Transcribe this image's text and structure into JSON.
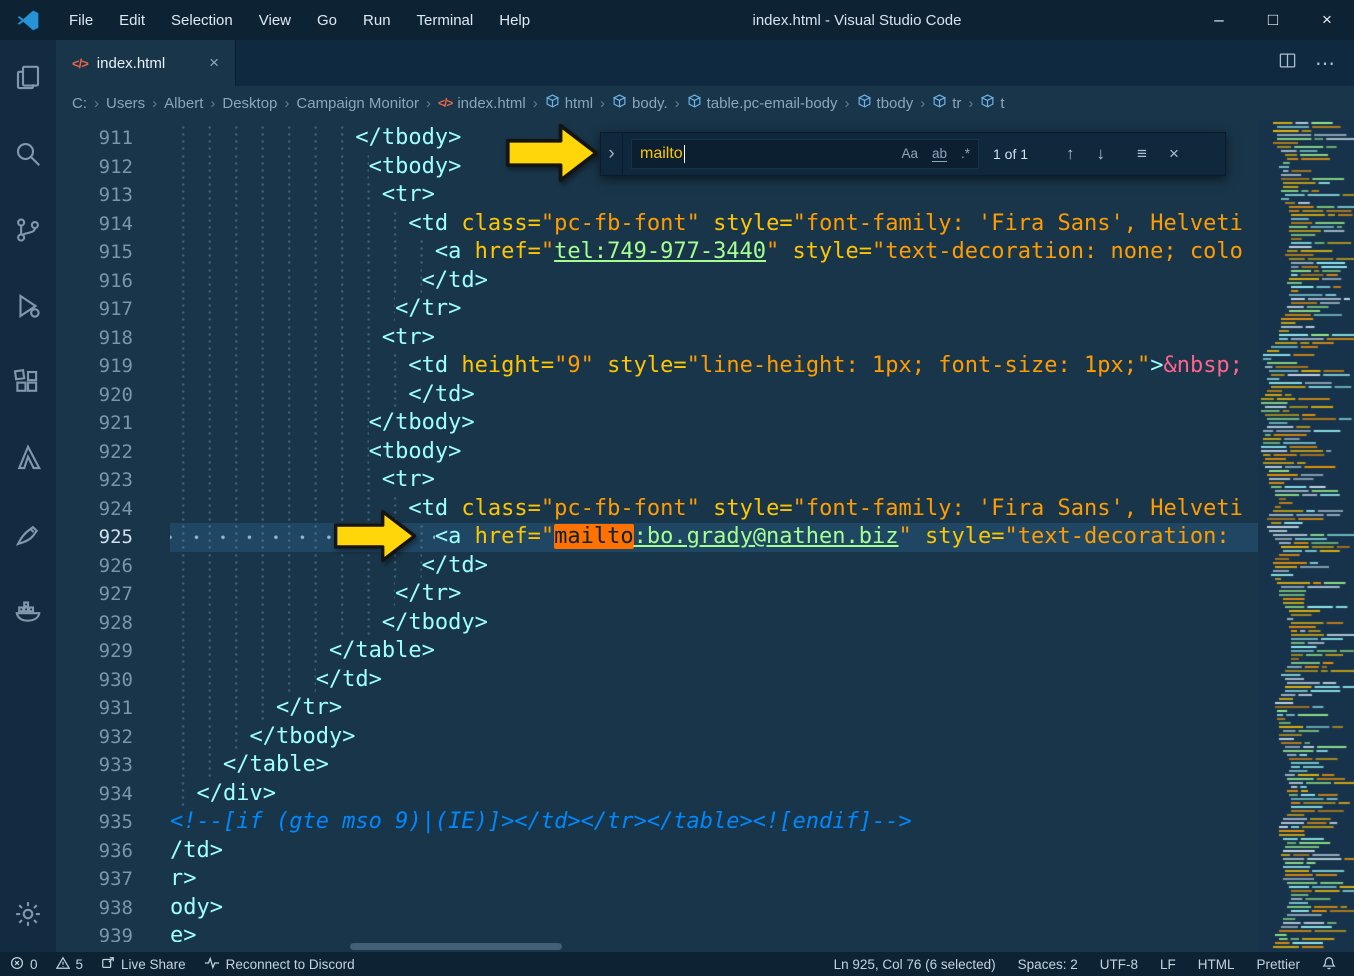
{
  "window": {
    "title": "index.html - Visual Studio Code",
    "minimize": "–",
    "maximize": "□",
    "close": "×"
  },
  "menubar": {
    "items": [
      "File",
      "Edit",
      "Selection",
      "View",
      "Go",
      "Run",
      "Terminal",
      "Help"
    ]
  },
  "activity_bar": {
    "top": [
      "explorer",
      "search",
      "source-control",
      "run-debug",
      "extensions",
      "azure",
      "live-share",
      "docker"
    ],
    "bottom": [
      "settings"
    ]
  },
  "tab_bar": {
    "tab_label": "index.html",
    "tab_close": "×",
    "more_actions": "⋯"
  },
  "breadcrumbs": {
    "items": [
      {
        "label": "C:"
      },
      {
        "label": "Users"
      },
      {
        "label": "Albert"
      },
      {
        "label": "Desktop"
      },
      {
        "label": "Campaign Monitor"
      },
      {
        "label": "index.html",
        "icon": "html"
      },
      {
        "label": "html",
        "icon": "cube"
      },
      {
        "label": "body.",
        "icon": "cube"
      },
      {
        "label": "table.pc-email-body",
        "icon": "cube"
      },
      {
        "label": "tbody",
        "icon": "cube"
      },
      {
        "label": "tr",
        "icon": "cube"
      },
      {
        "label": "t",
        "icon": "cube"
      }
    ]
  },
  "find": {
    "expand": "›",
    "query": "mailto",
    "match_case": "Aa",
    "whole_word": "ab",
    "use_regex": ".*",
    "results": "1 of 1",
    "prev": "↑",
    "next": "↓",
    "in_selection": "≡",
    "close": "×"
  },
  "editor": {
    "lines": [
      {
        "n": 911,
        "i": 14,
        "t": [
          [
            "tag",
            "</tbody>"
          ]
        ]
      },
      {
        "n": 912,
        "i": 15,
        "t": [
          [
            "tag",
            "<tbody>"
          ]
        ]
      },
      {
        "n": 913,
        "i": 16,
        "t": [
          [
            "tag",
            "<tr>"
          ]
        ]
      },
      {
        "n": 914,
        "i": 18,
        "t": [
          [
            "tag",
            "<td"
          ],
          [
            "pln",
            " "
          ],
          [
            "attr",
            "class="
          ],
          [
            "str",
            "\"pc-fb-font\""
          ],
          [
            "pln",
            " "
          ],
          [
            "attr",
            "style="
          ],
          [
            "str",
            "\"font-family: 'Fira Sans', Helveti"
          ]
        ]
      },
      {
        "n": 915,
        "i": 20,
        "t": [
          [
            "tag",
            "<a"
          ],
          [
            "pln",
            " "
          ],
          [
            "attr",
            "href="
          ],
          [
            "str",
            "\""
          ],
          [
            "link",
            "tel:749-977-3440"
          ],
          [
            "str",
            "\""
          ],
          [
            "pln",
            " "
          ],
          [
            "attr",
            "style="
          ],
          [
            "str",
            "\"text-decoration: none; colo"
          ]
        ]
      },
      {
        "n": 916,
        "i": 19,
        "t": [
          [
            "tag",
            "</td>"
          ]
        ]
      },
      {
        "n": 917,
        "i": 17,
        "t": [
          [
            "tag",
            "</tr>"
          ]
        ]
      },
      {
        "n": 918,
        "i": 16,
        "t": [
          [
            "tag",
            "<tr>"
          ]
        ]
      },
      {
        "n": 919,
        "i": 18,
        "t": [
          [
            "tag",
            "<td"
          ],
          [
            "pln",
            " "
          ],
          [
            "attr",
            "height="
          ],
          [
            "str",
            "\"9\""
          ],
          [
            "pln",
            " "
          ],
          [
            "attr",
            "style="
          ],
          [
            "str",
            "\"line-height: 1px; font-size: 1px;\""
          ],
          [
            "tag",
            ">"
          ],
          [
            "ent",
            "&nbsp;"
          ]
        ]
      },
      {
        "n": 920,
        "i": 18,
        "t": [
          [
            "tag",
            "</td>"
          ]
        ]
      },
      {
        "n": 921,
        "i": 15,
        "t": [
          [
            "tag",
            "</tbody>"
          ]
        ]
      },
      {
        "n": 922,
        "i": 15,
        "t": [
          [
            "tag",
            "<tbody>"
          ]
        ]
      },
      {
        "n": 923,
        "i": 16,
        "t": [
          [
            "tag",
            "<tr>"
          ]
        ]
      },
      {
        "n": 924,
        "i": 18,
        "t": [
          [
            "tag",
            "<td"
          ],
          [
            "pln",
            " "
          ],
          [
            "attr",
            "class="
          ],
          [
            "str",
            "\"pc-fb-font\""
          ],
          [
            "pln",
            " "
          ],
          [
            "attr",
            "style="
          ],
          [
            "str",
            "\"font-family: 'Fira Sans', Helveti"
          ]
        ]
      },
      {
        "n": 925,
        "i": 20,
        "c": true,
        "t": [
          [
            "tag",
            "<a"
          ],
          [
            "pln",
            " "
          ],
          [
            "attr",
            "href="
          ],
          [
            "str",
            "\""
          ],
          [
            "match",
            "mailto"
          ],
          [
            "link",
            ":bo.grady@nathen.biz"
          ],
          [
            "str",
            "\""
          ],
          [
            "pln",
            " "
          ],
          [
            "attr",
            "style="
          ],
          [
            "str",
            "\"text-decoration:"
          ]
        ]
      },
      {
        "n": 926,
        "i": 19,
        "t": [
          [
            "tag",
            "</td>"
          ]
        ]
      },
      {
        "n": 927,
        "i": 17,
        "t": [
          [
            "tag",
            "</tr>"
          ]
        ]
      },
      {
        "n": 928,
        "i": 16,
        "t": [
          [
            "tag",
            "</tbody>"
          ]
        ]
      },
      {
        "n": 929,
        "i": 12,
        "t": [
          [
            "tag",
            "</table>"
          ]
        ]
      },
      {
        "n": 930,
        "i": 11,
        "t": [
          [
            "tag",
            "</td>"
          ]
        ]
      },
      {
        "n": 931,
        "i": 8,
        "t": [
          [
            "tag",
            "</tr>"
          ]
        ]
      },
      {
        "n": 932,
        "i": 6,
        "t": [
          [
            "tag",
            "</tbody>"
          ]
        ]
      },
      {
        "n": 933,
        "i": 4,
        "t": [
          [
            "tag",
            "</table>"
          ]
        ]
      },
      {
        "n": 934,
        "i": 2,
        "t": [
          [
            "tag",
            "</div>"
          ]
        ]
      },
      {
        "n": 935,
        "i": 0,
        "t": [
          [
            "cmt",
            "<!--[if (gte mso 9)|(IE)]></td></tr></table><![endif]-->"
          ]
        ]
      },
      {
        "n": 936,
        "i": -1,
        "t": [
          [
            "tag",
            "</td>"
          ]
        ]
      },
      {
        "n": 937,
        "i": -3,
        "t": [
          [
            "tag",
            "</tr>"
          ]
        ]
      },
      {
        "n": 938,
        "i": -4,
        "t": [
          [
            "tag",
            "</tbody>"
          ]
        ]
      },
      {
        "n": 939,
        "i": -6,
        "t": [
          [
            "tag",
            "</table>"
          ]
        ]
      }
    ]
  },
  "minimap": {
    "colors": [
      "#9effff",
      "#ffc600",
      "#ff9d00",
      "#a5ff90",
      "#d6e9f5"
    ]
  },
  "status_bar": {
    "left": [
      {
        "icon": "error",
        "text": "0"
      },
      {
        "icon": "warning",
        "text": "5"
      },
      {
        "icon": "live-share",
        "text": "Live Share"
      },
      {
        "icon": "pulse",
        "text": "Reconnect to Discord"
      }
    ],
    "right": [
      {
        "text": "Ln 925, Col 76 (6 selected)"
      },
      {
        "text": "Spaces: 2"
      },
      {
        "text": "UTF-8"
      },
      {
        "text": "LF"
      },
      {
        "text": "HTML"
      },
      {
        "text": "Prettier"
      },
      {
        "icon": "bell",
        "text": ""
      }
    ]
  },
  "colors": {
    "editor_bg": "#193549",
    "line_highlight": "#1F4662",
    "find_match": "#ff7200",
    "tag": "#9effff",
    "attribute": "#ffc600",
    "string": "#ff9d00",
    "link": "#a5ff90",
    "entity": "#ff628c",
    "comment": "#0088ff",
    "arrow": "#ffd60a"
  }
}
